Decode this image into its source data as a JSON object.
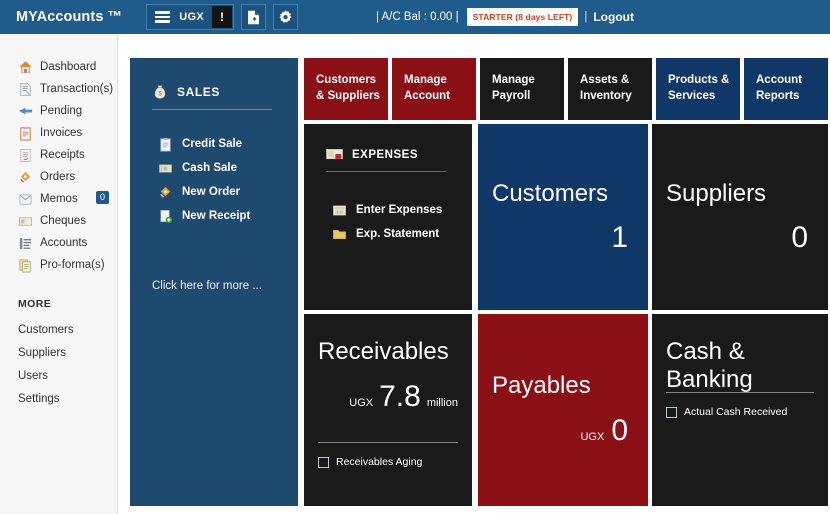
{
  "header": {
    "brand": "MYAccounts ™",
    "currency": "UGX",
    "alert_label": "!",
    "new_doc_icon": "document-plus-icon",
    "settings_icon": "gear-icon",
    "menu_icon": "hamburger-menu-icon",
    "balance_label": "| A/C Bal : 0.00  |",
    "plan_badge": "STARTER (8 days LEFT)",
    "plan_separator": "|",
    "logout": "Logout"
  },
  "sidebar": {
    "items": [
      {
        "label": "Dashboard",
        "icon": "home-icon",
        "badge": null
      },
      {
        "label": "Transaction(s)",
        "icon": "transactions-icon",
        "badge": null
      },
      {
        "label": "Pending",
        "icon": "pending-arrow-icon",
        "badge": null
      },
      {
        "label": "Invoices",
        "icon": "clipboard-icon",
        "badge": null
      },
      {
        "label": "Receipts",
        "icon": "receipt-icon",
        "badge": null
      },
      {
        "label": "Orders",
        "icon": "orders-icon",
        "badge": null
      },
      {
        "label": "Memos",
        "icon": "memo-envelope-icon",
        "badge": "0"
      },
      {
        "label": "Cheques",
        "icon": "cheque-icon",
        "badge": null
      },
      {
        "label": "Accounts",
        "icon": "accounts-list-icon",
        "badge": null
      },
      {
        "label": "Pro-forma(s)",
        "icon": "proforma-icon",
        "badge": null
      }
    ],
    "more_heading": "MORE",
    "more_items": [
      {
        "label": "Customers"
      },
      {
        "label": "Suppliers"
      },
      {
        "label": "Users"
      },
      {
        "label": "Settings"
      }
    ]
  },
  "sales_panel": {
    "title": "SALES",
    "icon": "money-bag-icon",
    "links": [
      {
        "label": "Credit Sale",
        "icon": "clipboard-icon"
      },
      {
        "label": "Cash Sale",
        "icon": "cash-icon"
      },
      {
        "label": "New Order",
        "icon": "order-icon"
      },
      {
        "label": "New Receipt",
        "icon": "new-receipt-icon"
      }
    ],
    "more_link": "Click here for more ..."
  },
  "top_tiles": [
    {
      "label": "Customers\n& Suppliers",
      "color": "#8b1015"
    },
    {
      "label": "Manage\nAccount",
      "color": "#8b1015"
    },
    {
      "label": "Manage\nPayroll",
      "color": "#1a1a1a"
    },
    {
      "label": "Assets &\nInventory",
      "color": "#1a1a1a"
    },
    {
      "label": "Products &\nServices",
      "color": "#0f3868"
    },
    {
      "label": "Account\nReports",
      "color": "#0f3868"
    }
  ],
  "expenses_panel": {
    "title": "EXPENSES",
    "icon": "banknote-icon",
    "links": [
      {
        "label": "Enter Expenses",
        "icon": "calculator-icon"
      },
      {
        "label": "Exp. Statement",
        "icon": "folder-icon"
      }
    ]
  },
  "metrics": {
    "customers": {
      "title": "Customers",
      "value": "1",
      "color": "#0f3868"
    },
    "suppliers": {
      "title": "Suppliers",
      "value": "0",
      "color": "#1a1a1a"
    },
    "receivables": {
      "title": "Receivables",
      "currency": "UGX",
      "value": "7.8",
      "scale": "million",
      "link": "Receivables Aging",
      "color": "#1a1a1a"
    },
    "payables": {
      "title": "Payables",
      "currency": "UGX",
      "value": "0",
      "color": "#8b1015"
    },
    "cash_banking": {
      "title": "Cash & Banking",
      "link": "Actual Cash Received",
      "color": "#1a1a1a"
    }
  },
  "colors": {
    "topbar": "#1f5c8b",
    "sales_blue": "#1f4a70",
    "navy": "#0f3868",
    "dark_red": "#8b1015",
    "black": "#1a1a1a",
    "sidebar_bg": "#f7f7f7"
  }
}
